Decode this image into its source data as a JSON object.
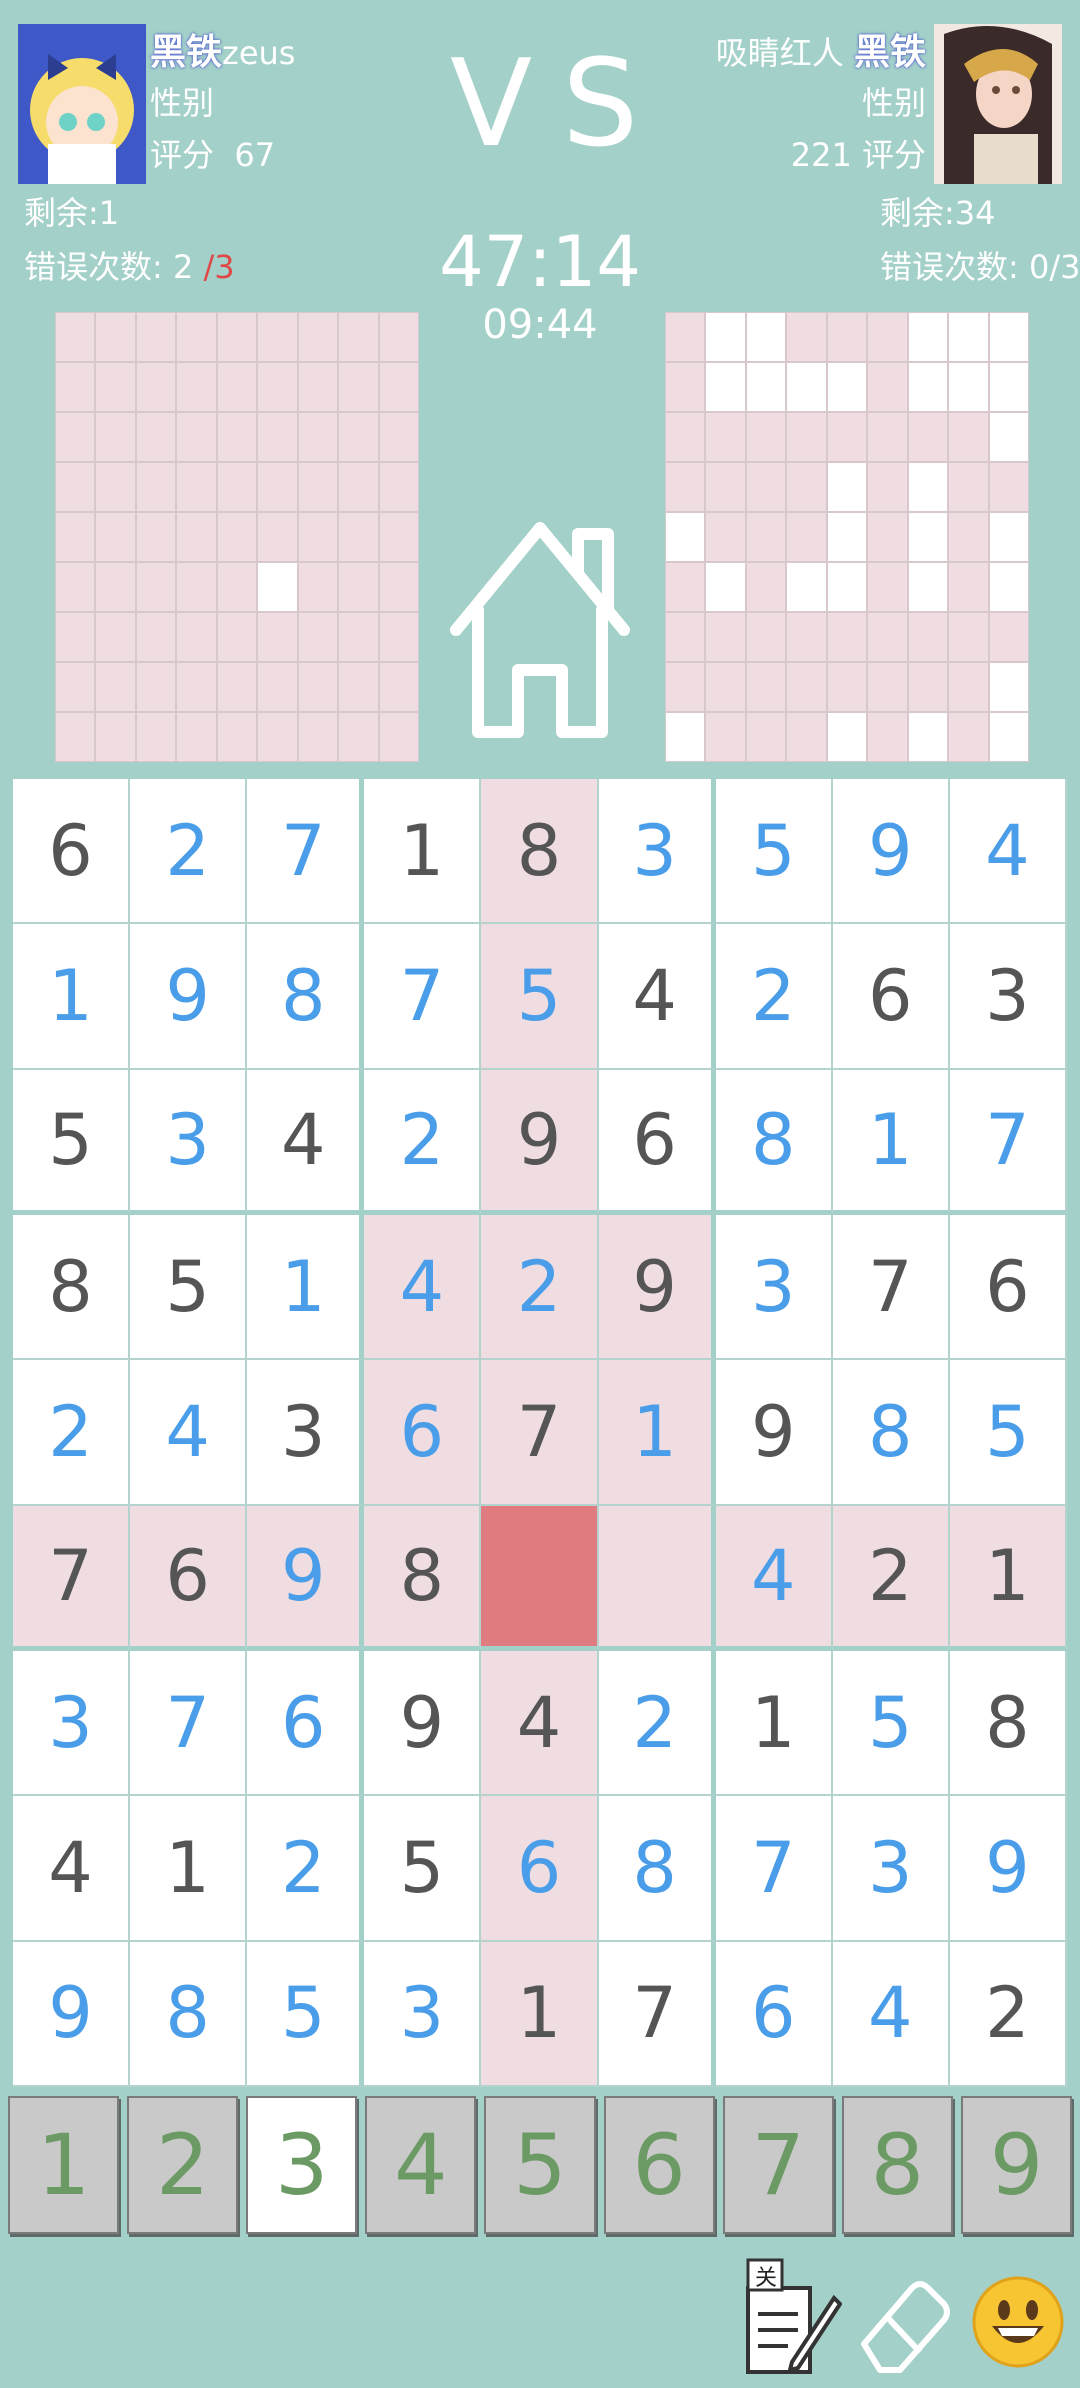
{
  "left_player": {
    "rank": "黑铁",
    "name": "zeus",
    "gender_label": "性别",
    "score_label": "评分",
    "score": "67",
    "remaining_label": "剩余:",
    "remaining": "1",
    "errors_label": "错误次数:",
    "errors": "2",
    "errors_max": "/3"
  },
  "right_player": {
    "name": "吸睛红人",
    "rank": "黑铁",
    "gender_label": "性别",
    "score": "221",
    "score_label": "评分",
    "remaining_label": "剩余:",
    "remaining": "34",
    "errors_label": "错误次数:",
    "errors": "0",
    "errors_max": "/3"
  },
  "vs_label": "VS",
  "countdown": "47:14",
  "clock": "09:44",
  "left_mini_board": [
    "ppppppppp",
    "ppppppppp",
    "ppppppppp",
    "ppppppppp",
    "ppppppppp",
    "pppppwppp",
    "ppppppppp",
    "ppppppppp",
    "ppppppppp"
  ],
  "right_mini_board": [
    "pwwpppwww",
    "pwwwwpwww",
    "ppppppppw",
    "ppppwpwpp",
    "wpppwpwpw",
    "pwpwwpwpw",
    "ppppppppp",
    "ppppppppw",
    "wpppwpwpw"
  ],
  "board": [
    [
      {
        "v": "6",
        "t": "g"
      },
      {
        "v": "2",
        "t": "u"
      },
      {
        "v": "7",
        "t": "u"
      },
      {
        "v": "1",
        "t": "g"
      },
      {
        "v": "8",
        "t": "g"
      },
      {
        "v": "3",
        "t": "u"
      },
      {
        "v": "5",
        "t": "u"
      },
      {
        "v": "9",
        "t": "u"
      },
      {
        "v": "4",
        "t": "u"
      }
    ],
    [
      {
        "v": "1",
        "t": "u"
      },
      {
        "v": "9",
        "t": "u"
      },
      {
        "v": "8",
        "t": "u"
      },
      {
        "v": "7",
        "t": "u"
      },
      {
        "v": "5",
        "t": "u"
      },
      {
        "v": "4",
        "t": "g"
      },
      {
        "v": "2",
        "t": "u"
      },
      {
        "v": "6",
        "t": "g"
      },
      {
        "v": "3",
        "t": "g"
      }
    ],
    [
      {
        "v": "5",
        "t": "g"
      },
      {
        "v": "3",
        "t": "u"
      },
      {
        "v": "4",
        "t": "g"
      },
      {
        "v": "2",
        "t": "u"
      },
      {
        "v": "9",
        "t": "g"
      },
      {
        "v": "6",
        "t": "g"
      },
      {
        "v": "8",
        "t": "u"
      },
      {
        "v": "1",
        "t": "u"
      },
      {
        "v": "7",
        "t": "u"
      }
    ],
    [
      {
        "v": "8",
        "t": "g"
      },
      {
        "v": "5",
        "t": "g"
      },
      {
        "v": "1",
        "t": "u"
      },
      {
        "v": "4",
        "t": "u"
      },
      {
        "v": "2",
        "t": "u"
      },
      {
        "v": "9",
        "t": "g"
      },
      {
        "v": "3",
        "t": "u"
      },
      {
        "v": "7",
        "t": "g"
      },
      {
        "v": "6",
        "t": "g"
      }
    ],
    [
      {
        "v": "2",
        "t": "u"
      },
      {
        "v": "4",
        "t": "u"
      },
      {
        "v": "3",
        "t": "g"
      },
      {
        "v": "6",
        "t": "u"
      },
      {
        "v": "7",
        "t": "g"
      },
      {
        "v": "1",
        "t": "u"
      },
      {
        "v": "9",
        "t": "g"
      },
      {
        "v": "8",
        "t": "u"
      },
      {
        "v": "5",
        "t": "u"
      }
    ],
    [
      {
        "v": "7",
        "t": "g"
      },
      {
        "v": "6",
        "t": "g"
      },
      {
        "v": "9",
        "t": "u"
      },
      {
        "v": "8",
        "t": "g"
      },
      {
        "v": "",
        "t": "sel"
      },
      {
        "v": "",
        "t": "g"
      },
      {
        "v": "4",
        "t": "u"
      },
      {
        "v": "2",
        "t": "g"
      },
      {
        "v": "1",
        "t": "g"
      }
    ],
    [
      {
        "v": "3",
        "t": "u"
      },
      {
        "v": "7",
        "t": "u"
      },
      {
        "v": "6",
        "t": "u"
      },
      {
        "v": "9",
        "t": "g"
      },
      {
        "v": "4",
        "t": "g"
      },
      {
        "v": "2",
        "t": "u"
      },
      {
        "v": "1",
        "t": "g"
      },
      {
        "v": "5",
        "t": "u"
      },
      {
        "v": "8",
        "t": "g"
      }
    ],
    [
      {
        "v": "4",
        "t": "g"
      },
      {
        "v": "1",
        "t": "g"
      },
      {
        "v": "2",
        "t": "u"
      },
      {
        "v": "5",
        "t": "g"
      },
      {
        "v": "6",
        "t": "u"
      },
      {
        "v": "8",
        "t": "u"
      },
      {
        "v": "7",
        "t": "u"
      },
      {
        "v": "3",
        "t": "u"
      },
      {
        "v": "9",
        "t": "u"
      }
    ],
    [
      {
        "v": "9",
        "t": "u"
      },
      {
        "v": "8",
        "t": "u"
      },
      {
        "v": "5",
        "t": "u"
      },
      {
        "v": "3",
        "t": "u"
      },
      {
        "v": "1",
        "t": "g"
      },
      {
        "v": "7",
        "t": "g"
      },
      {
        "v": "6",
        "t": "u"
      },
      {
        "v": "4",
        "t": "u"
      },
      {
        "v": "2",
        "t": "g"
      }
    ]
  ],
  "highlight": {
    "row": 5,
    "col": 4
  },
  "numpad": [
    {
      "label": "1",
      "done": false
    },
    {
      "label": "2",
      "done": false
    },
    {
      "label": "3",
      "done": true
    },
    {
      "label": "4",
      "done": false
    },
    {
      "label": "5",
      "done": false
    },
    {
      "label": "6",
      "done": false
    },
    {
      "label": "7",
      "done": false
    },
    {
      "label": "8",
      "done": false
    },
    {
      "label": "9",
      "done": false
    }
  ],
  "tools": {
    "notes_badge": "关"
  },
  "colors": {
    "background": "#a3d0c8",
    "highlight": "#f0dde1",
    "selected": "#e07b7f",
    "user_digit": "#4a9de8",
    "given_digit": "#555555",
    "numpad_digit": "#6c9a64"
  }
}
